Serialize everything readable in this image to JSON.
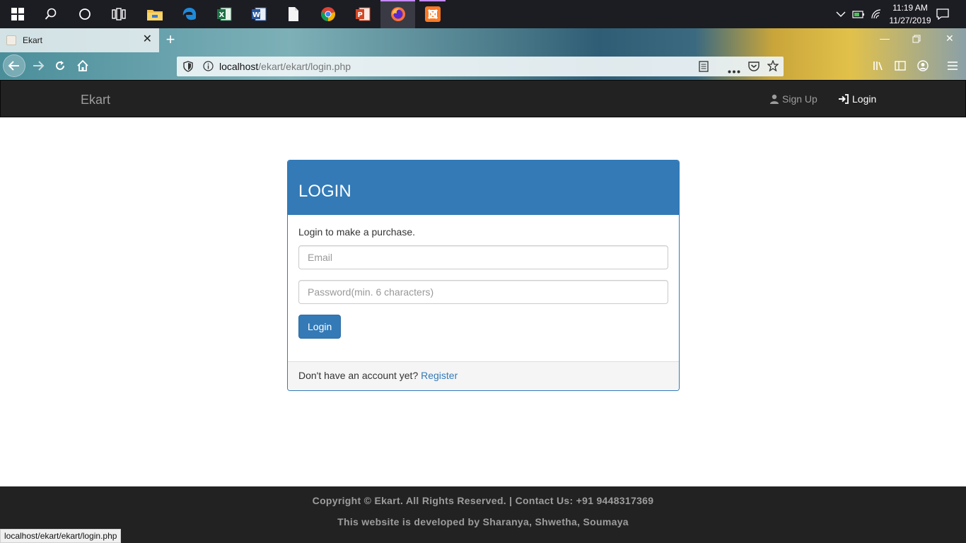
{
  "taskbar": {
    "clock_time": "11:19 AM",
    "clock_date": "11/27/2019",
    "apps": [
      "start",
      "search",
      "cortana",
      "task-view",
      "file-explorer",
      "edge",
      "excel",
      "word",
      "file",
      "chrome",
      "powerpoint",
      "firefox",
      "xampp"
    ]
  },
  "browser": {
    "tab_title": "Ekart",
    "url_host": "localhost",
    "url_path": "/ekart/ekart/login.php",
    "status_url": "localhost/ekart/ekart/login.php"
  },
  "navbar": {
    "brand": "Ekart",
    "signup": "Sign Up",
    "login": "Login"
  },
  "login": {
    "heading": "LOGIN",
    "lead": "Login to make a purchase.",
    "email_placeholder": "Email",
    "password_placeholder": "Password(min. 6 characters)",
    "submit": "Login",
    "footer_text": "Don't have an account yet?",
    "register_link": "Register"
  },
  "footer": {
    "copyright": "Copyright © Ekart. All Rights Reserved. | Contact Us: +91 9448317369",
    "developers": "This website is developed by Sharanya, Shwetha, Soumaya"
  },
  "colors": {
    "primary": "#337ab7",
    "navbar": "#222222",
    "taskbar": "#1c1c23"
  }
}
